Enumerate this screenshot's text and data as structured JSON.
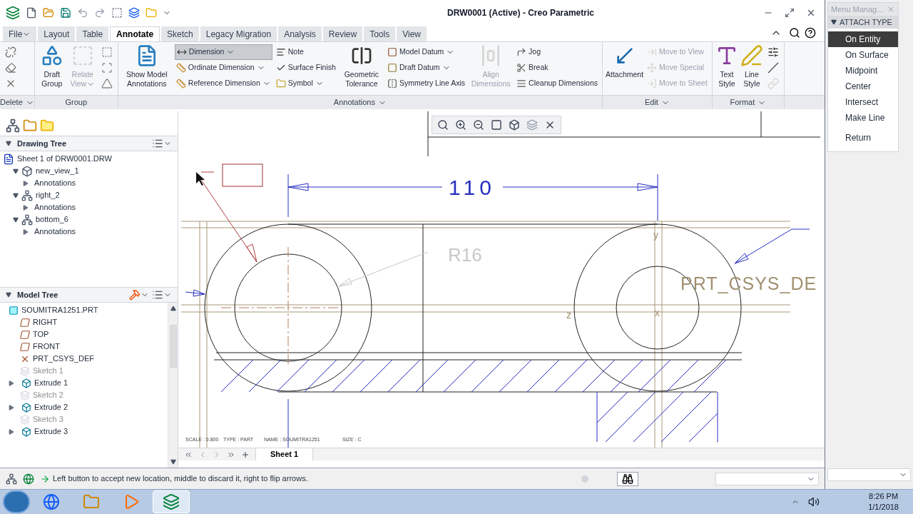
{
  "window": {
    "title": "DRW0001 (Active) - Creo Parametric"
  },
  "tabs": [
    {
      "label": "File",
      "selected": false,
      "dropdown": true
    },
    {
      "label": "Layout",
      "selected": false,
      "dropdown": false
    },
    {
      "label": "Table",
      "selected": false,
      "dropdown": false
    },
    {
      "label": "Annotate",
      "selected": true,
      "dropdown": false
    },
    {
      "label": "Sketch",
      "selected": false,
      "dropdown": false
    },
    {
      "label": "Legacy Migration",
      "selected": false,
      "dropdown": false
    },
    {
      "label": "Analysis",
      "selected": false,
      "dropdown": false
    },
    {
      "label": "Review",
      "selected": false,
      "dropdown": false
    },
    {
      "label": "Tools",
      "selected": false,
      "dropdown": false
    },
    {
      "label": "View",
      "selected": false,
      "dropdown": false
    }
  ],
  "ribbon": [
    {
      "label": "Delete",
      "dropdown": true,
      "columns": [
        [
          {
            "kind": "icon",
            "disabled": false
          },
          {
            "kind": "icon",
            "disabled": false
          },
          {
            "kind": "icon",
            "disabled": false
          }
        ]
      ]
    },
    {
      "label": "Group",
      "dropdown": false,
      "columns": [
        [
          {
            "kind": "large",
            "label": "Draft Group",
            "disabled": false,
            "dropdown": false
          }
        ],
        [
          {
            "kind": "large",
            "label": "Relate View",
            "disabled": true,
            "dropdown": true
          }
        ],
        [
          {
            "kind": "icon",
            "disabled": false
          },
          {
            "kind": "icon",
            "disabled": false
          },
          {
            "kind": "icon",
            "disabled": false
          }
        ]
      ]
    },
    {
      "label": "Annotations",
      "dropdown": true,
      "columns": [
        [
          {
            "kind": "large",
            "label": "Show Model Annotations",
            "disabled": false,
            "dropdown": false
          }
        ],
        [
          {
            "kind": "small",
            "label": "Dimension",
            "disabled": false,
            "dropdown": true,
            "selected": true
          },
          {
            "kind": "small",
            "label": "Ordinate Dimension",
            "disabled": false,
            "dropdown": true,
            "selected": false
          },
          {
            "kind": "small",
            "label": "Reference Dimension",
            "disabled": false,
            "dropdown": true,
            "selected": false
          }
        ],
        [
          {
            "kind": "small",
            "label": "Note",
            "disabled": false,
            "dropdown": false
          },
          {
            "kind": "small",
            "label": "Surface Finish",
            "disabled": false,
            "dropdown": false
          },
          {
            "kind": "small",
            "label": "Symbol",
            "disabled": false,
            "dropdown": true
          }
        ],
        [
          {
            "kind": "large",
            "label": "Geometric Tolerance",
            "disabled": false,
            "dropdown": false
          }
        ],
        [
          {
            "kind": "small",
            "label": "Model Datum",
            "disabled": false,
            "dropdown": true
          },
          {
            "kind": "small",
            "label": "Draft Datum",
            "disabled": false,
            "dropdown": true
          },
          {
            "kind": "small",
            "label": "Symmetry Line Axis",
            "disabled": false,
            "dropdown": false
          }
        ],
        [
          {
            "kind": "large",
            "label": "Align Dimensions",
            "disabled": true,
            "dropdown": false
          }
        ],
        [
          {
            "kind": "small",
            "label": "Jog",
            "disabled": false,
            "dropdown": false
          },
          {
            "kind": "small",
            "label": "Break",
            "disabled": false,
            "dropdown": false
          },
          {
            "kind": "small",
            "label": "Cleanup Dimensions",
            "disabled": false,
            "dropdown": false
          }
        ]
      ]
    },
    {
      "label": "Edit",
      "dropdown": true,
      "columns": [
        [
          {
            "kind": "large",
            "label": "Attachment",
            "disabled": false,
            "dropdown": false
          }
        ],
        [
          {
            "kind": "small",
            "label": "Move to View",
            "disabled": true,
            "dropdown": false
          },
          {
            "kind": "small",
            "label": "Move Special",
            "disabled": true,
            "dropdown": false
          },
          {
            "kind": "small",
            "label": "Move to Sheet",
            "disabled": true,
            "dropdown": false
          }
        ]
      ]
    },
    {
      "label": "Format",
      "dropdown": true,
      "columns": [
        [
          {
            "kind": "large",
            "label": "Text Style",
            "disabled": false,
            "dropdown": false
          }
        ],
        [
          {
            "kind": "large",
            "label": "Line Style",
            "disabled": false,
            "dropdown": false
          }
        ],
        [
          {
            "kind": "icon",
            "disabled": false
          },
          {
            "kind": "icon",
            "disabled": false
          },
          {
            "kind": "icon",
            "disabled": true
          }
        ]
      ]
    }
  ],
  "drawing_tree": {
    "title": "Drawing Tree",
    "items": [
      {
        "label": "Sheet 1 of DRW0001.DRW",
        "kind": "sheet",
        "children": [
          {
            "label": "new_view_1",
            "kind": "general_view",
            "expanded": true,
            "children": [
              {
                "label": "Annotations",
                "expanded": false
              }
            ]
          },
          {
            "label": "right_2",
            "kind": "projection_view",
            "expanded": true,
            "children": [
              {
                "label": "Annotations",
                "expanded": false
              }
            ]
          },
          {
            "label": "bottom_6",
            "kind": "projection_view",
            "expanded": true,
            "children": [
              {
                "label": "Annotations",
                "expanded": false
              }
            ]
          }
        ]
      }
    ]
  },
  "model_tree": {
    "title": "Model Tree",
    "items": [
      {
        "label": "SOUMITRA1251.PRT",
        "kind": "part",
        "disabled": false
      },
      {
        "label": "RIGHT",
        "kind": "datum",
        "disabled": false
      },
      {
        "label": "TOP",
        "kind": "datum",
        "disabled": false
      },
      {
        "label": "FRONT",
        "kind": "datum",
        "disabled": false
      },
      {
        "label": "PRT_CSYS_DEF",
        "kind": "csys",
        "disabled": false
      },
      {
        "label": "Sketch 1",
        "kind": "sketch",
        "disabled": true
      },
      {
        "label": "Extrude 1",
        "kind": "feature",
        "disabled": false
      },
      {
        "label": "Sketch 2",
        "kind": "sketch",
        "disabled": true
      },
      {
        "label": "Extrude 2",
        "kind": "feature",
        "disabled": false
      },
      {
        "label": "Sketch 3",
        "kind": "sketch",
        "disabled": true
      },
      {
        "label": "Extrude 3",
        "kind": "feature",
        "disabled": false
      }
    ]
  },
  "drawing": {
    "dimension": "110",
    "radius": "R16",
    "csys_label": "PRT_CSYS_DE",
    "axis_labels": [
      "y",
      "x",
      "z"
    ],
    "title_block": [
      "SCALE : 0.800",
      "TYPE : PART",
      "NAME : SOUMITRA1251",
      "SIZE : C"
    ]
  },
  "sheet_tabs": [
    {
      "label": "Sheet 1",
      "selected": true
    }
  ],
  "status_bar": {
    "message": "Left button to accept new location, middle to discard it, right to flip arrows."
  },
  "menu_manager": {
    "title": "Menu Manag...",
    "section": "ATTACH TYPE",
    "items": [
      {
        "label": "On Entity",
        "selected": true
      },
      {
        "label": "On Surface",
        "selected": false
      },
      {
        "label": "Midpoint",
        "selected": false
      },
      {
        "label": "Center",
        "selected": false
      },
      {
        "label": "Intersect",
        "selected": false
      },
      {
        "label": "Make Line",
        "selected": false
      }
    ],
    "return_label": "Return"
  },
  "taskbar": {
    "apps": [
      {
        "selected": false
      },
      {
        "selected": false
      },
      {
        "selected": false
      },
      {
        "selected": true
      }
    ],
    "time": "8:26 PM",
    "date": "1/1/2018"
  }
}
